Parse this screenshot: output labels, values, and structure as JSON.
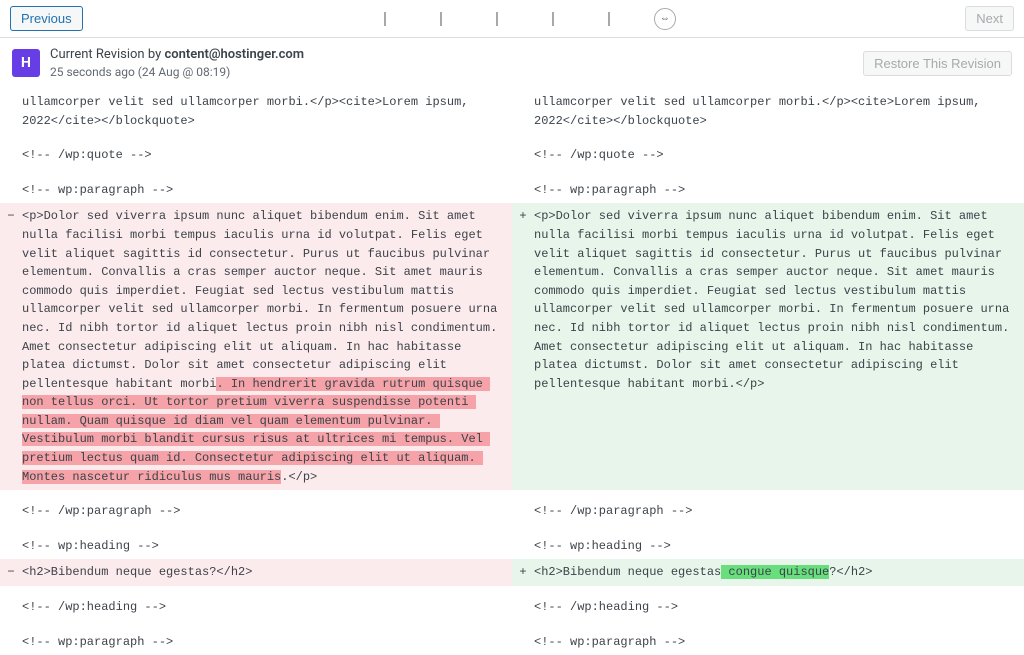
{
  "nav": {
    "prev_label": "Previous",
    "next_label": "Next",
    "slider_handle_glyph": "⇔"
  },
  "revision": {
    "current_prefix": "Current Revision by ",
    "author": "content@hostinger.com",
    "ago_line": "25 seconds ago (24 Aug @ 08:19)",
    "restore_label": "Restore This Revision",
    "avatar_letter": "H"
  },
  "rows": [
    {
      "type": "ctx",
      "left": "ullamcorper velit sed ullamcorper morbi.</p><cite>Lorem ipsum, 2022</cite></blockquote>",
      "right": "ullamcorper velit sed ullamcorper morbi.</p><cite>Lorem ipsum, 2022</cite></blockquote>"
    },
    {
      "type": "ctx",
      "left": "",
      "right": ""
    },
    {
      "type": "ctx",
      "left": "<!-- /wp:quote -->",
      "right": "<!-- /wp:quote -->"
    },
    {
      "type": "ctx",
      "left": "",
      "right": ""
    },
    {
      "type": "ctx",
      "left": "<!-- wp:paragraph -->",
      "right": "<!-- wp:paragraph -->"
    },
    {
      "type": "change",
      "left_parts": [
        {
          "t": "<p>Dolor sed viverra ipsum nunc aliquet bibendum enim. Sit amet nulla facilisi morbi tempus iaculis urna id volutpat. Felis eget velit aliquet sagittis id consectetur. Purus ut faucibus pulvinar elementum. Convallis a cras semper auctor neque. Sit amet mauris commodo quis imperdiet. Feugiat sed lectus vestibulum mattis ullamcorper velit sed ullamcorper morbi. In fermentum posuere urna nec. Id nibh tortor id aliquet lectus proin nibh nisl condimentum. Amet consectetur adipiscing elit ut aliquam. In hac habitasse platea dictumst. Dolor sit amet consectetur adipiscing elit pellentesque habitant morbi",
          "h": false
        },
        {
          "t": ". In hendrerit gravida rutrum quisque non tellus orci. Ut tortor pretium viverra suspendisse potenti nullam. Quam quisque id diam vel quam elementum pulvinar. Vestibulum morbi blandit cursus risus at ultrices mi tempus. Vel pretium lectus quam id. Consectetur adipiscing elit ut aliquam. Montes nascetur ridiculus mus mauris",
          "h": true
        },
        {
          "t": ".</p>",
          "h": false
        }
      ],
      "right_parts": [
        {
          "t": "<p>Dolor sed viverra ipsum nunc aliquet bibendum enim. Sit amet nulla facilisi morbi tempus iaculis urna id volutpat. Felis eget velit aliquet sagittis id consectetur. Purus ut faucibus pulvinar elementum. Convallis a cras semper auctor neque. Sit amet mauris commodo quis imperdiet. Feugiat sed lectus vestibulum mattis ullamcorper velit sed ullamcorper morbi. In fermentum posuere urna nec. Id nibh tortor id aliquet lectus proin nibh nisl condimentum. Amet consectetur adipiscing elit ut aliquam. In hac habitasse platea dictumst. Dolor sit amet consectetur adipiscing elit pellentesque habitant morbi.</p>",
          "h": false
        }
      ]
    },
    {
      "type": "ctx",
      "left": "",
      "right": ""
    },
    {
      "type": "ctx",
      "left": "<!-- /wp:paragraph -->",
      "right": "<!-- /wp:paragraph -->"
    },
    {
      "type": "ctx",
      "left": "",
      "right": ""
    },
    {
      "type": "ctx",
      "left": "<!-- wp:heading -->",
      "right": "<!-- wp:heading -->"
    },
    {
      "type": "change",
      "left_parts": [
        {
          "t": "<h2>Bibendum neque egestas?</h2>",
          "h": false
        }
      ],
      "right_parts": [
        {
          "t": "<h2>Bibendum neque egestas",
          "h": false
        },
        {
          "t": " congue quisque",
          "h": true
        },
        {
          "t": "?</h2>",
          "h": false
        }
      ]
    },
    {
      "type": "ctx",
      "left": "",
      "right": ""
    },
    {
      "type": "ctx",
      "left": "<!-- /wp:heading -->",
      "right": "<!-- /wp:heading -->"
    },
    {
      "type": "ctx",
      "left": "",
      "right": ""
    },
    {
      "type": "ctx",
      "left": "<!-- wp:paragraph -->",
      "right": "<!-- wp:paragraph -->"
    }
  ]
}
